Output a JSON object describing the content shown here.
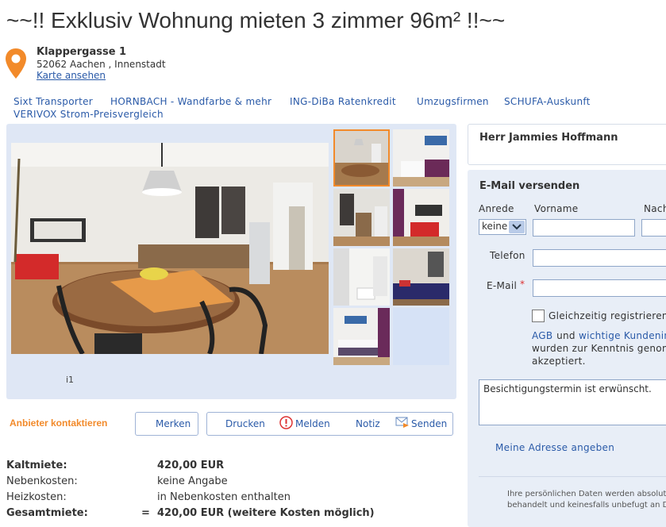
{
  "title": "~~!! Exklusiv Wohnung mieten 3 zimmer 96m² !!~~",
  "address": {
    "street": "Klappergasse 1",
    "city": "52062 Aachen , Innenstadt",
    "map_link": "Karte ansehen"
  },
  "ad_links": [
    "Sixt Transporter",
    "HORNBACH - Wandfarbe & mehr",
    "ING-DiBa Ratenkredit",
    "Umzugsfirmen",
    "SCHUFA-Auskunft",
    "VERIVOX Strom-Preisvergleich"
  ],
  "gallery": {
    "caption": "i1"
  },
  "actions": {
    "contact": "Anbieter kontaktieren",
    "save": "Merken",
    "print": "Drucken",
    "report": "Melden",
    "note": "Notiz",
    "send": "Senden"
  },
  "prices": [
    {
      "label": "Kaltmiete:",
      "value": "420,00 EUR",
      "bold": true
    },
    {
      "label": "Nebenkosten:",
      "value": "keine Angabe",
      "bold": false
    },
    {
      "label": "Heizkosten:",
      "value": "in Nebenkosten enthalten",
      "bold": false
    },
    {
      "label": "Gesamtmiete:",
      "prefix": "=",
      "value": "420,00 EUR (weitere Kosten möglich)",
      "bold": true
    }
  ],
  "seller": {
    "name": "Herr Jammies Hoffmann"
  },
  "mail_form": {
    "heading": "E-Mail versenden",
    "salutation_label": "Anrede",
    "salutation_value": "keine",
    "firstname_label": "Vorname",
    "lastname_label": "Nach",
    "phone_label": "Telefon",
    "email_label": "E-Mail",
    "required_mark": "*",
    "register_label": "Gleichzeitig registrieren",
    "terms_link1": "AGB",
    "terms_and": " und ",
    "terms_link2": "wichtige Kundenin",
    "terms_line2": "wurden zur Kenntnis genom",
    "terms_line3": "akzeptiert.",
    "message": "Besichtigungstermin ist erwünscht.",
    "address_link": "Meine Adresse angeben",
    "privacy_line1": "Ihre persönlichen Daten werden absolut",
    "privacy_line2": "behandelt und keinesfalls unbefugt an D"
  },
  "colors": {
    "accent": "#f28a2a",
    "link": "#2a5aa8",
    "panel": "#dfe7f5"
  },
  "icons": [
    "location-pin-icon",
    "alert-icon",
    "mail-send-icon",
    "chevron-down-icon"
  ]
}
